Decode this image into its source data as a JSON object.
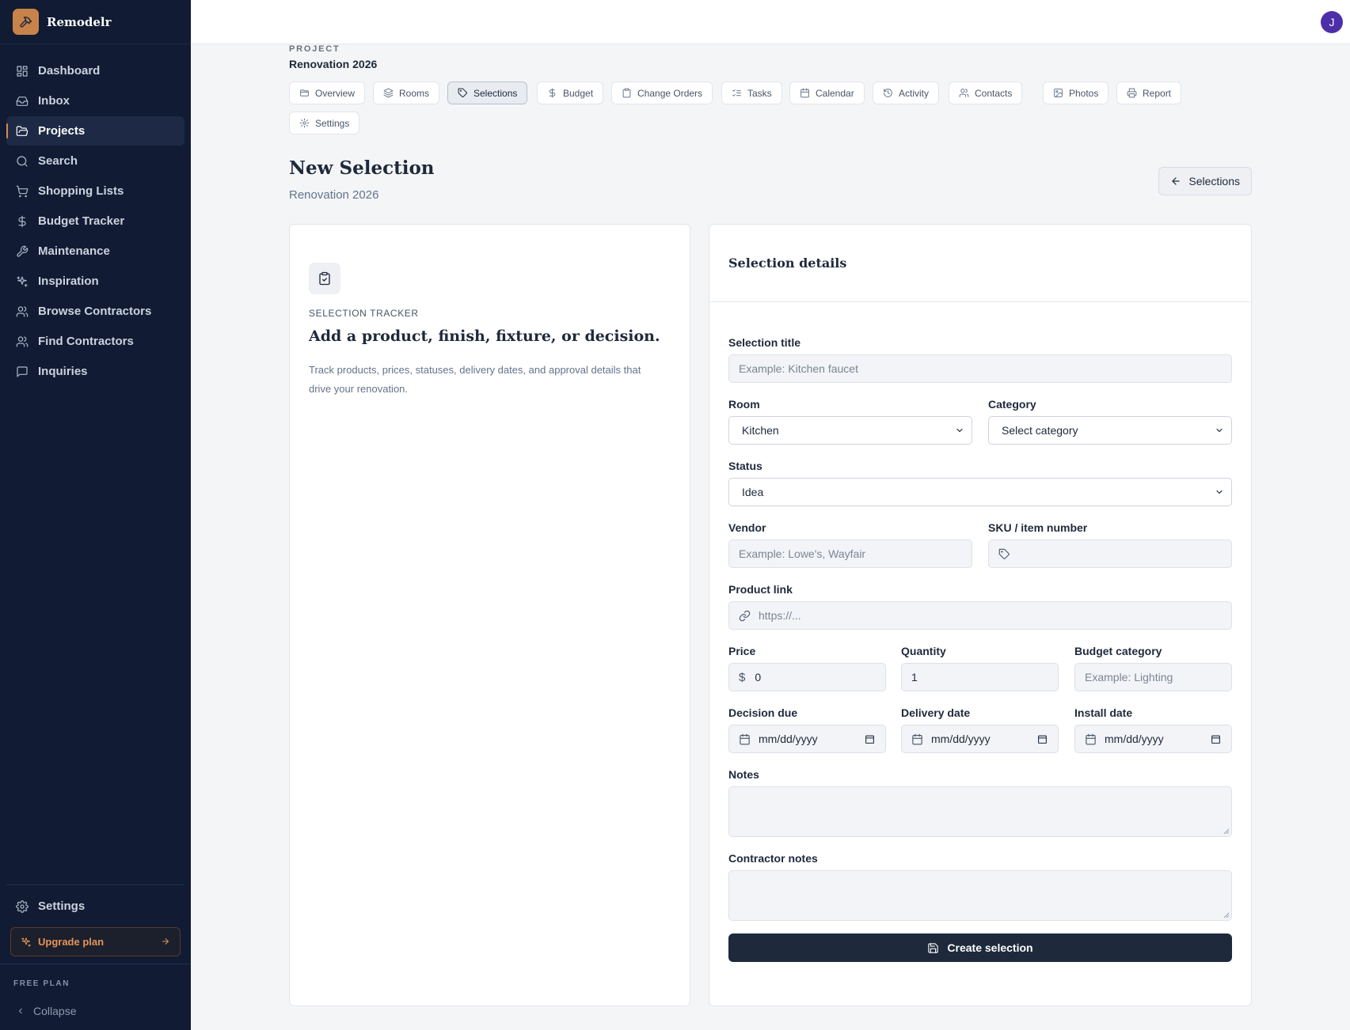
{
  "app": {
    "name": "Remodelr"
  },
  "sidebar": {
    "items": [
      {
        "label": "Dashboard",
        "icon": "grid-icon"
      },
      {
        "label": "Inbox",
        "icon": "inbox-icon"
      },
      {
        "label": "Projects",
        "icon": "folder-icon",
        "active": true
      },
      {
        "label": "Search",
        "icon": "search-icon"
      },
      {
        "label": "Shopping Lists",
        "icon": "cart-icon"
      },
      {
        "label": "Budget Tracker",
        "icon": "dollar-icon"
      },
      {
        "label": "Maintenance",
        "icon": "wrench-icon"
      },
      {
        "label": "Inspiration",
        "icon": "sparkles-icon"
      },
      {
        "label": "Browse Contractors",
        "icon": "users-icon"
      },
      {
        "label": "Find Contractors",
        "icon": "users-icon"
      },
      {
        "label": "Inquiries",
        "icon": "message-icon"
      }
    ],
    "settings_label": "Settings",
    "upgrade_label": "Upgrade plan",
    "plan_label": "FREE PLAN",
    "collapse_label": "Collapse",
    "accent_color": "#d88a4a"
  },
  "topbar": {
    "avatar_initial": "J",
    "avatar_color": "#4c2fa8"
  },
  "project": {
    "kicker": "PROJECT",
    "name": "Renovation 2026",
    "tabs": [
      {
        "label": "Overview",
        "icon": "folder-open-icon"
      },
      {
        "label": "Rooms",
        "icon": "layers-icon"
      },
      {
        "label": "Selections",
        "icon": "tag-icon",
        "active": true
      },
      {
        "label": "Budget",
        "icon": "dollar-icon"
      },
      {
        "label": "Change Orders",
        "icon": "clipboard-icon"
      },
      {
        "label": "Tasks",
        "icon": "list-checks-icon"
      },
      {
        "label": "Calendar",
        "icon": "calendar-icon"
      },
      {
        "label": "Activity",
        "icon": "history-icon"
      },
      {
        "label": "Contacts",
        "icon": "users-icon"
      },
      {
        "label": "Photos",
        "icon": "image-icon"
      },
      {
        "label": "Report",
        "icon": "printer-icon"
      },
      {
        "label": "Settings",
        "icon": "gear-icon"
      }
    ]
  },
  "page": {
    "title": "New Selection",
    "subtitle": "Renovation 2026",
    "back_label": "Selections"
  },
  "tracker": {
    "kicker": "SELECTION TRACKER",
    "title": "Add a product, finish, fixture, or decision.",
    "description": "Track products, prices, statuses, delivery dates, and approval details that drive your renovation."
  },
  "form": {
    "heading": "Selection details",
    "title_label": "Selection title",
    "title_placeholder": "Example: Kitchen faucet",
    "room_label": "Room",
    "room_value": "Kitchen",
    "category_label": "Category",
    "category_value": "Select category",
    "status_label": "Status",
    "status_value": "Idea",
    "vendor_label": "Vendor",
    "vendor_placeholder": "Example: Lowe's, Wayfair",
    "sku_label": "SKU / item number",
    "link_label": "Product link",
    "link_placeholder": "https://...",
    "price_label": "Price",
    "price_symbol": "$",
    "price_value": "0",
    "quantity_label": "Quantity",
    "quantity_value": "1",
    "budget_category_label": "Budget category",
    "budget_category_placeholder": "Example: Lighting",
    "decision_due_label": "Decision due",
    "delivery_date_label": "Delivery date",
    "install_date_label": "Install date",
    "date_placeholder": "mm/dd/yyyy",
    "notes_label": "Notes",
    "contractor_notes_label": "Contractor notes",
    "submit_label": "Create selection"
  }
}
